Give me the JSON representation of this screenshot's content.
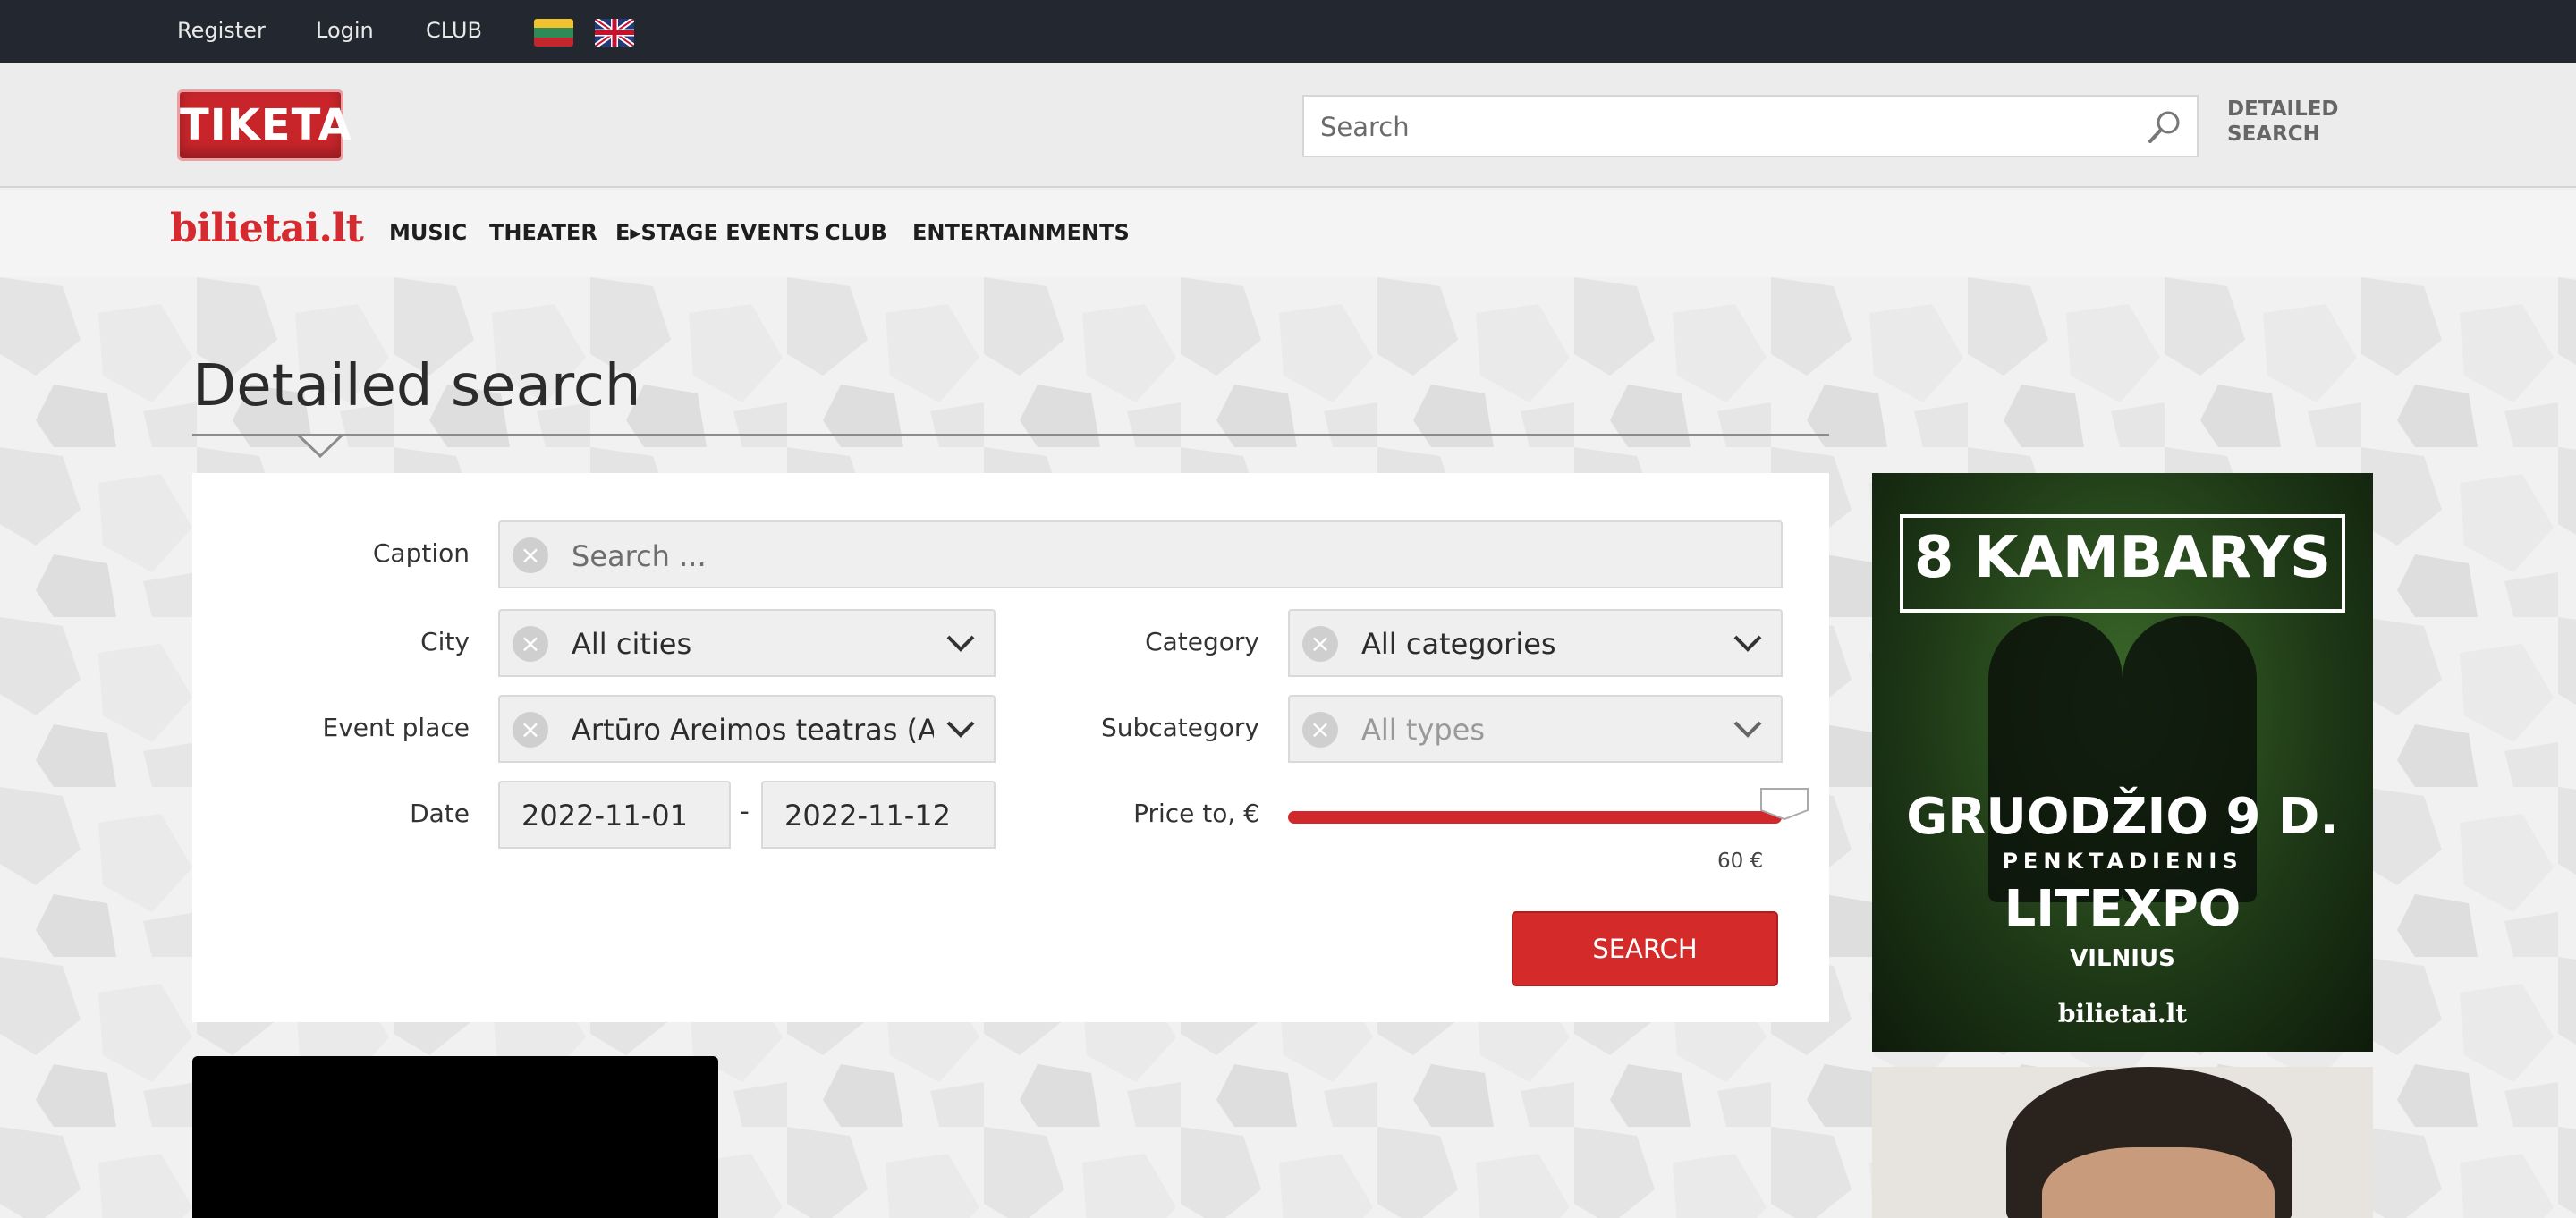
{
  "topbar": {
    "register": "Register",
    "login": "Login",
    "club": "CLUB",
    "flags": [
      "flag-lt-icon",
      "flag-uk-icon"
    ]
  },
  "header": {
    "logo": "TIKETA",
    "search_placeholder": "Search",
    "detailed_line1": "DETAILED",
    "detailed_line2": "SEARCH"
  },
  "nav": {
    "brand": "bilietai.lt",
    "items": [
      "MUSIC",
      "THEATER",
      "E▸STAGE EVENTS",
      "CLUB",
      "ENTERTAINMENTS"
    ]
  },
  "page": {
    "title": "Detailed search"
  },
  "form": {
    "caption_label": "Caption",
    "caption_placeholder": "Search ...",
    "city_label": "City",
    "city_value": "All cities",
    "category_label": "Category",
    "category_value": "All categories",
    "event_place_label": "Event place",
    "event_place_value": "Artūro Areimos teatras (A...",
    "subcategory_label": "Subcategory",
    "subcategory_value": "All types",
    "date_label": "Date",
    "date_from": "2022-11-01",
    "date_sep": "-",
    "date_to": "2022-11-12",
    "price_label": "Price to, €",
    "price_value": "60 €",
    "price_fraction": 1.0,
    "search_button": "SEARCH"
  },
  "ads": {
    "ad1_title": "8 KAMBARYS",
    "ad1_date": "GRUODŽIO 9 D.",
    "ad1_day": "PENKTADIENIS",
    "ad1_venue": "LITEXPO",
    "ad1_city": "VILNIUS",
    "ad1_brand": "bilietai.lt"
  },
  "colors": {
    "accent": "#d42a2a",
    "topbar": "#232830"
  }
}
